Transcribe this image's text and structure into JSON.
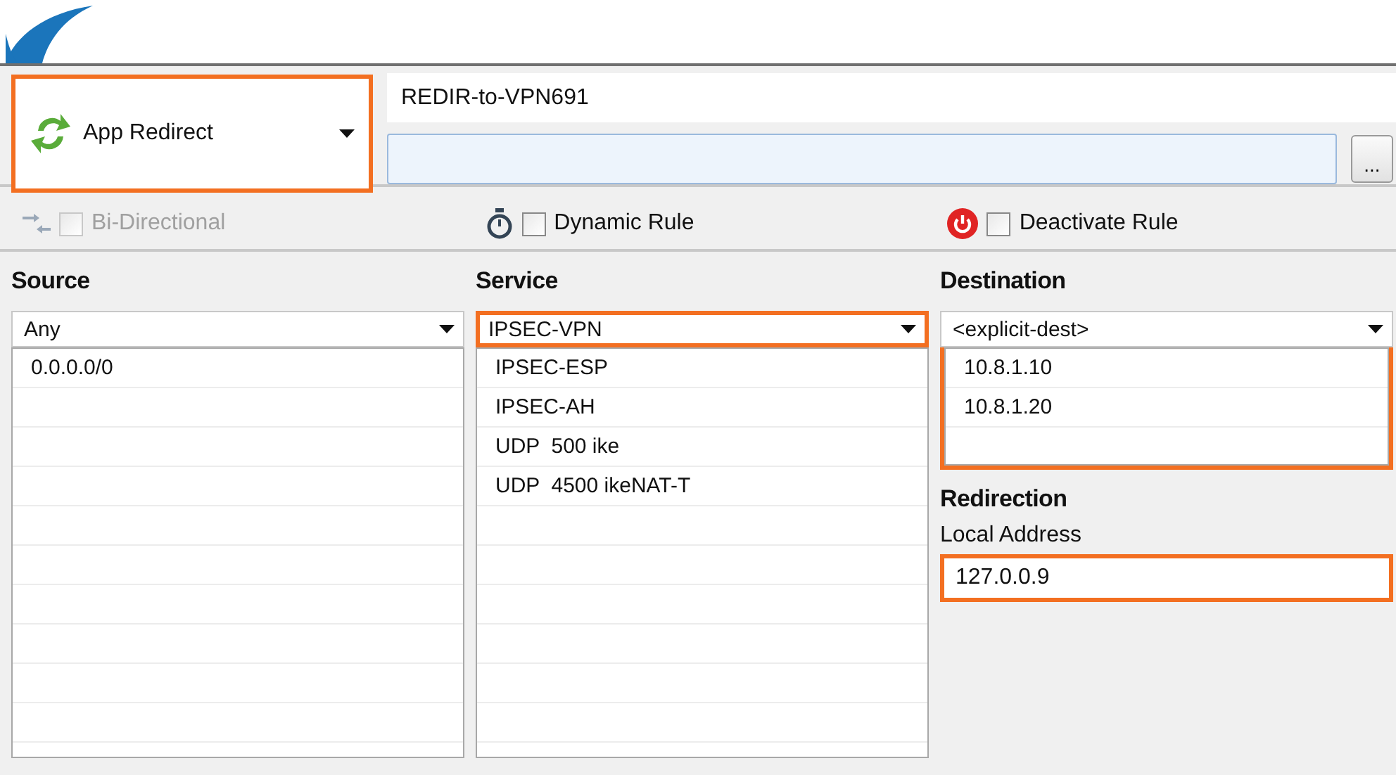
{
  "action": {
    "label": "App Redirect",
    "highlighted": true
  },
  "rule_name": {
    "value": "REDIR-to-VPN691"
  },
  "browse_button": {
    "label": "..."
  },
  "options": [
    {
      "kind": "bidirectional",
      "label": "Bi-Directional",
      "checked": false,
      "disabled": true
    },
    {
      "kind": "dynamic",
      "label": "Dynamic Rule",
      "checked": false,
      "disabled": false
    },
    {
      "kind": "deactivate",
      "label": "Deactivate Rule",
      "checked": false,
      "disabled": false
    }
  ],
  "source": {
    "heading": "Source",
    "selection": "Any",
    "highlighted": false,
    "items": [
      "0.0.0.0/0"
    ]
  },
  "service": {
    "heading": "Service",
    "selection": "IPSEC-VPN",
    "highlighted": true,
    "items": [
      "IPSEC-ESP",
      "IPSEC-AH",
      "UDP  500 ike",
      "UDP  4500 ikeNAT-T"
    ]
  },
  "destination": {
    "heading": "Destination",
    "selection": "<explicit-dest>",
    "highlighted": true,
    "items": [
      "10.8.1.10",
      "10.8.1.20"
    ]
  },
  "redirection": {
    "heading": "Redirection",
    "label": "Local Address",
    "value": "127.0.0.9",
    "highlighted": true
  }
}
